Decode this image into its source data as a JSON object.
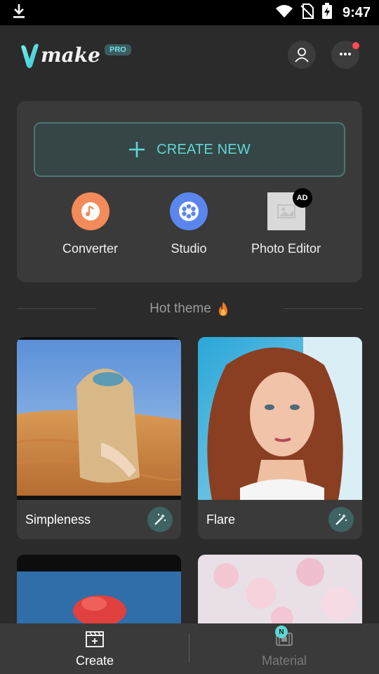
{
  "status_bar": {
    "time": "9:47"
  },
  "header": {
    "logo_text": "make",
    "pro_badge": "PRO"
  },
  "create_panel": {
    "create_new_label": "CREATE NEW",
    "tools": [
      {
        "label": "Converter",
        "icon": "music-note-icon",
        "color": "#f38a5a"
      },
      {
        "label": "Studio",
        "icon": "film-reel-icon",
        "color": "#5a86ee"
      },
      {
        "label": "Photo Editor",
        "icon": "image-placeholder-icon",
        "badge": "AD"
      }
    ]
  },
  "hot_theme": {
    "title": "Hot theme",
    "cards": [
      {
        "title": "Simpleness"
      },
      {
        "title": "Flare"
      }
    ]
  },
  "bottom_nav": {
    "items": [
      {
        "label": "Create",
        "icon": "clapperboard-icon",
        "active": true
      },
      {
        "label": "Material",
        "icon": "film-icon",
        "badge": "N",
        "active": false
      }
    ]
  },
  "colors": {
    "accent": "#5ed6d3",
    "background": "#2b2b2b",
    "panel": "#3a3a3a",
    "notification": "#ff4b57"
  }
}
